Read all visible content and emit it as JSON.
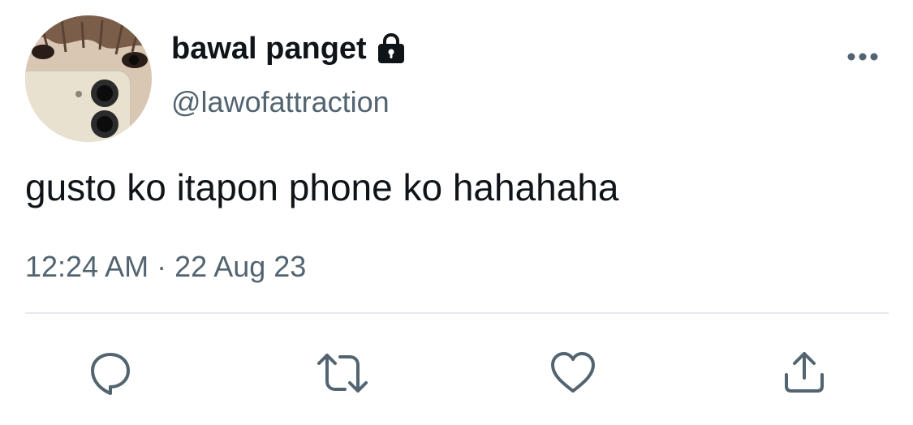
{
  "tweet": {
    "author": {
      "display_name": "bawal panget",
      "handle": "@lawofattraction",
      "protected_icon": "lock-icon"
    },
    "text": "gusto ko itapon phone ko hahahaha",
    "time": "12:24 AM",
    "separator": "·",
    "date": "22 Aug 23"
  },
  "actions": [
    {
      "icon": "reply-icon"
    },
    {
      "icon": "retweet-icon"
    },
    {
      "icon": "like-icon"
    },
    {
      "icon": "share-icon"
    }
  ],
  "colors": {
    "text": "#0f1419",
    "secondary_text": "#536471",
    "icon": "#536471",
    "divider": "#e6e9ec",
    "background": "#ffffff"
  }
}
